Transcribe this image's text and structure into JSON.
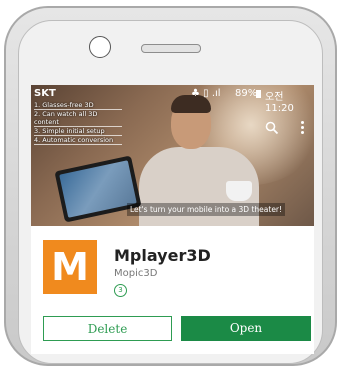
{
  "status_bar": {
    "carrier": "SKT",
    "signal_icons": "♣ ▯ .ıl",
    "battery": "89%",
    "time": "오전 11:20"
  },
  "banner": {
    "features": [
      "1. Glasses-free 3D",
      "2. Can watch all 3D content",
      "3. Simple initial setup",
      "4. Automatic conversion"
    ],
    "tagline": "Let's turn your mobile into a 3D theater!"
  },
  "app": {
    "icon_letter": "M",
    "icon_color": "#f08a1e",
    "name": "Mplayer3D",
    "developer": "Mopic3D",
    "rating_badge": "3"
  },
  "actions": {
    "delete_label": "Delete",
    "open_label": "Open",
    "accent_color": "#1b8a46"
  }
}
